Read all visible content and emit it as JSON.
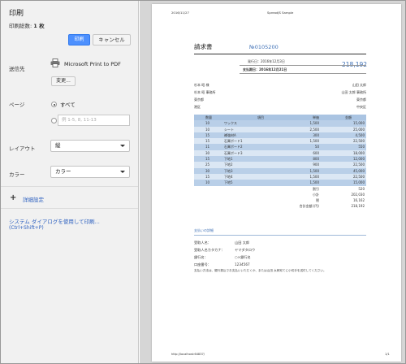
{
  "panel": {
    "title": "印刷",
    "total_label": "印刷総数:",
    "total_value": "1 枚",
    "print_button": "印刷",
    "cancel_button": "キャンセル",
    "destination_label": "送信先",
    "printer_name": "Microsoft Print to PDF",
    "change_button": "変更...",
    "pages_label": "ページ",
    "pages_all_option": "すべて",
    "pages_placeholder": "例 1-5, 8, 11-13",
    "layout_label": "レイアウト",
    "layout_value": "縦",
    "color_label": "カラー",
    "color_value": "カラー",
    "advanced_link": "詳細設定",
    "system_dialog_link": "システム ダイアログを使用して印刷...",
    "system_dialog_shortcut": "(Ctrl+Shift+P)"
  },
  "preview": {
    "header_date": "2016/11/27",
    "header_title": "SpreadJS Sample",
    "invoice_title": "請求書",
    "invoice_no": "№0105200",
    "issue_date_label": "発行日：",
    "issue_date": "2016年12月3日",
    "due_date_label": "支払期日：",
    "due_date": "2016年12月21日",
    "total_amount": "218,192",
    "to_name": "杉本 昭 様",
    "to_office": "杉本 昭 事務所",
    "to_city": "東京都",
    "to_ward": "港区",
    "from_name": "山田 太郎",
    "from_office": "山田 太郎 事務所",
    "from_city": "東京都",
    "from_ward": "中央区",
    "table_headers": {
      "qty": "数量",
      "item": "項目",
      "price": "単価",
      "amount": "金額"
    },
    "rows": [
      {
        "qty": "10",
        "item": "ワックス",
        "price": "1,500",
        "amount": "15,000"
      },
      {
        "qty": "10",
        "item": "シート",
        "price": "2,500",
        "amount": "25,000"
      },
      {
        "qty": "15",
        "item": "補強材A",
        "price": "300",
        "amount": "4,500"
      },
      {
        "qty": "15",
        "item": "石膏ボード1",
        "price": "1,500",
        "amount": "22,500"
      },
      {
        "qty": "11",
        "item": "石膏ボード2",
        "price": "50",
        "amount": "550"
      },
      {
        "qty": "30",
        "item": "石膏ボード3",
        "price": "600",
        "amount": "18,000"
      },
      {
        "qty": "15",
        "item": "下地1",
        "price": "800",
        "amount": "12,000"
      },
      {
        "qty": "25",
        "item": "下地2",
        "price": "900",
        "amount": "22,500"
      },
      {
        "qty": "30",
        "item": "下地3",
        "price": "1,500",
        "amount": "45,000"
      },
      {
        "qty": "15",
        "item": "下地4",
        "price": "1,500",
        "amount": "22,500"
      },
      {
        "qty": "10",
        "item": "下地5",
        "price": "1,500",
        "amount": "15,000"
      }
    ],
    "totals": [
      {
        "label": "割引",
        "value": "520"
      },
      {
        "label": "小計",
        "value": "202,030"
      },
      {
        "label": "税",
        "value": "16,162"
      },
      {
        "label": "合計金額 (円)",
        "value": "218,192"
      }
    ],
    "payment_title": "支払いの詳細",
    "payment": [
      {
        "label": "受取人名：",
        "value": "山田 太郎"
      },
      {
        "label": "受取人名カタカナ：",
        "value": "ヤマダタロウ"
      },
      {
        "label": "銀行名：",
        "value": "○×銀行名"
      },
      {
        "label": "口座番号：",
        "value": "1234567"
      }
    ],
    "note": "支払い方法は、銀行振込でお支払いいただくか、または山田 太郎宛てに小切手を送付してください。",
    "footer_url": "http://localhost:64837/",
    "footer_page": "1/1"
  },
  "colors": {
    "accent_blue": "#4d90fe",
    "link_blue": "#2b5fbf",
    "invoice_blue": "#3d6fb5",
    "table_row_dark": "#b9cfe8",
    "table_row_light": "#dbe7f4"
  }
}
